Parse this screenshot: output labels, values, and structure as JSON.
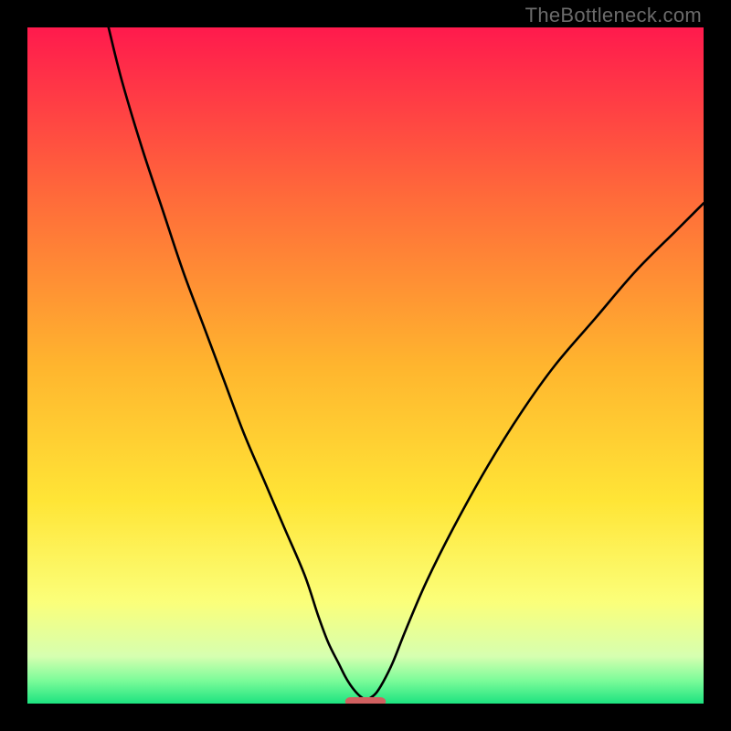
{
  "watermark": "TheBottleneck.com",
  "chart_data": {
    "type": "line",
    "title": "",
    "xlabel": "",
    "ylabel": "",
    "xlim": [
      0,
      100
    ],
    "ylim": [
      0,
      100
    ],
    "grid": false,
    "legend": false,
    "background_gradient_stops": [
      {
        "offset": 0.0,
        "color": "#ff1a4d"
      },
      {
        "offset": 0.25,
        "color": "#ff6a3a"
      },
      {
        "offset": 0.5,
        "color": "#ffb52e"
      },
      {
        "offset": 0.7,
        "color": "#ffe536"
      },
      {
        "offset": 0.85,
        "color": "#fbff7a"
      },
      {
        "offset": 0.93,
        "color": "#d6ffb0"
      },
      {
        "offset": 0.965,
        "color": "#7efc9a"
      },
      {
        "offset": 1.0,
        "color": "#1de380"
      }
    ],
    "series": [
      {
        "name": "bottleneck-curve",
        "x": [
          12,
          14,
          17,
          20,
          23,
          26,
          29,
          32,
          35,
          38,
          41,
          43,
          44.5,
          46,
          47,
          47.8,
          48.5,
          49.2,
          50,
          50.8,
          51.6,
          52.5,
          54,
          56,
          59,
          63,
          68,
          73,
          78,
          84,
          90,
          96,
          100
        ],
        "y": [
          100,
          92,
          82,
          73,
          64,
          56,
          48,
          40,
          33,
          26,
          19,
          13,
          9,
          6,
          4,
          2.7,
          1.8,
          1.1,
          0.6,
          0.9,
          1.6,
          3,
          6,
          11,
          18,
          26,
          35,
          43,
          50,
          57,
          64,
          70,
          74
        ]
      }
    ],
    "marker": {
      "name": "min-point-marker",
      "x": 50,
      "y": 0.3,
      "width_pct": 6,
      "height_pct": 1.3,
      "color": "#d06060",
      "rx": 6
    }
  }
}
